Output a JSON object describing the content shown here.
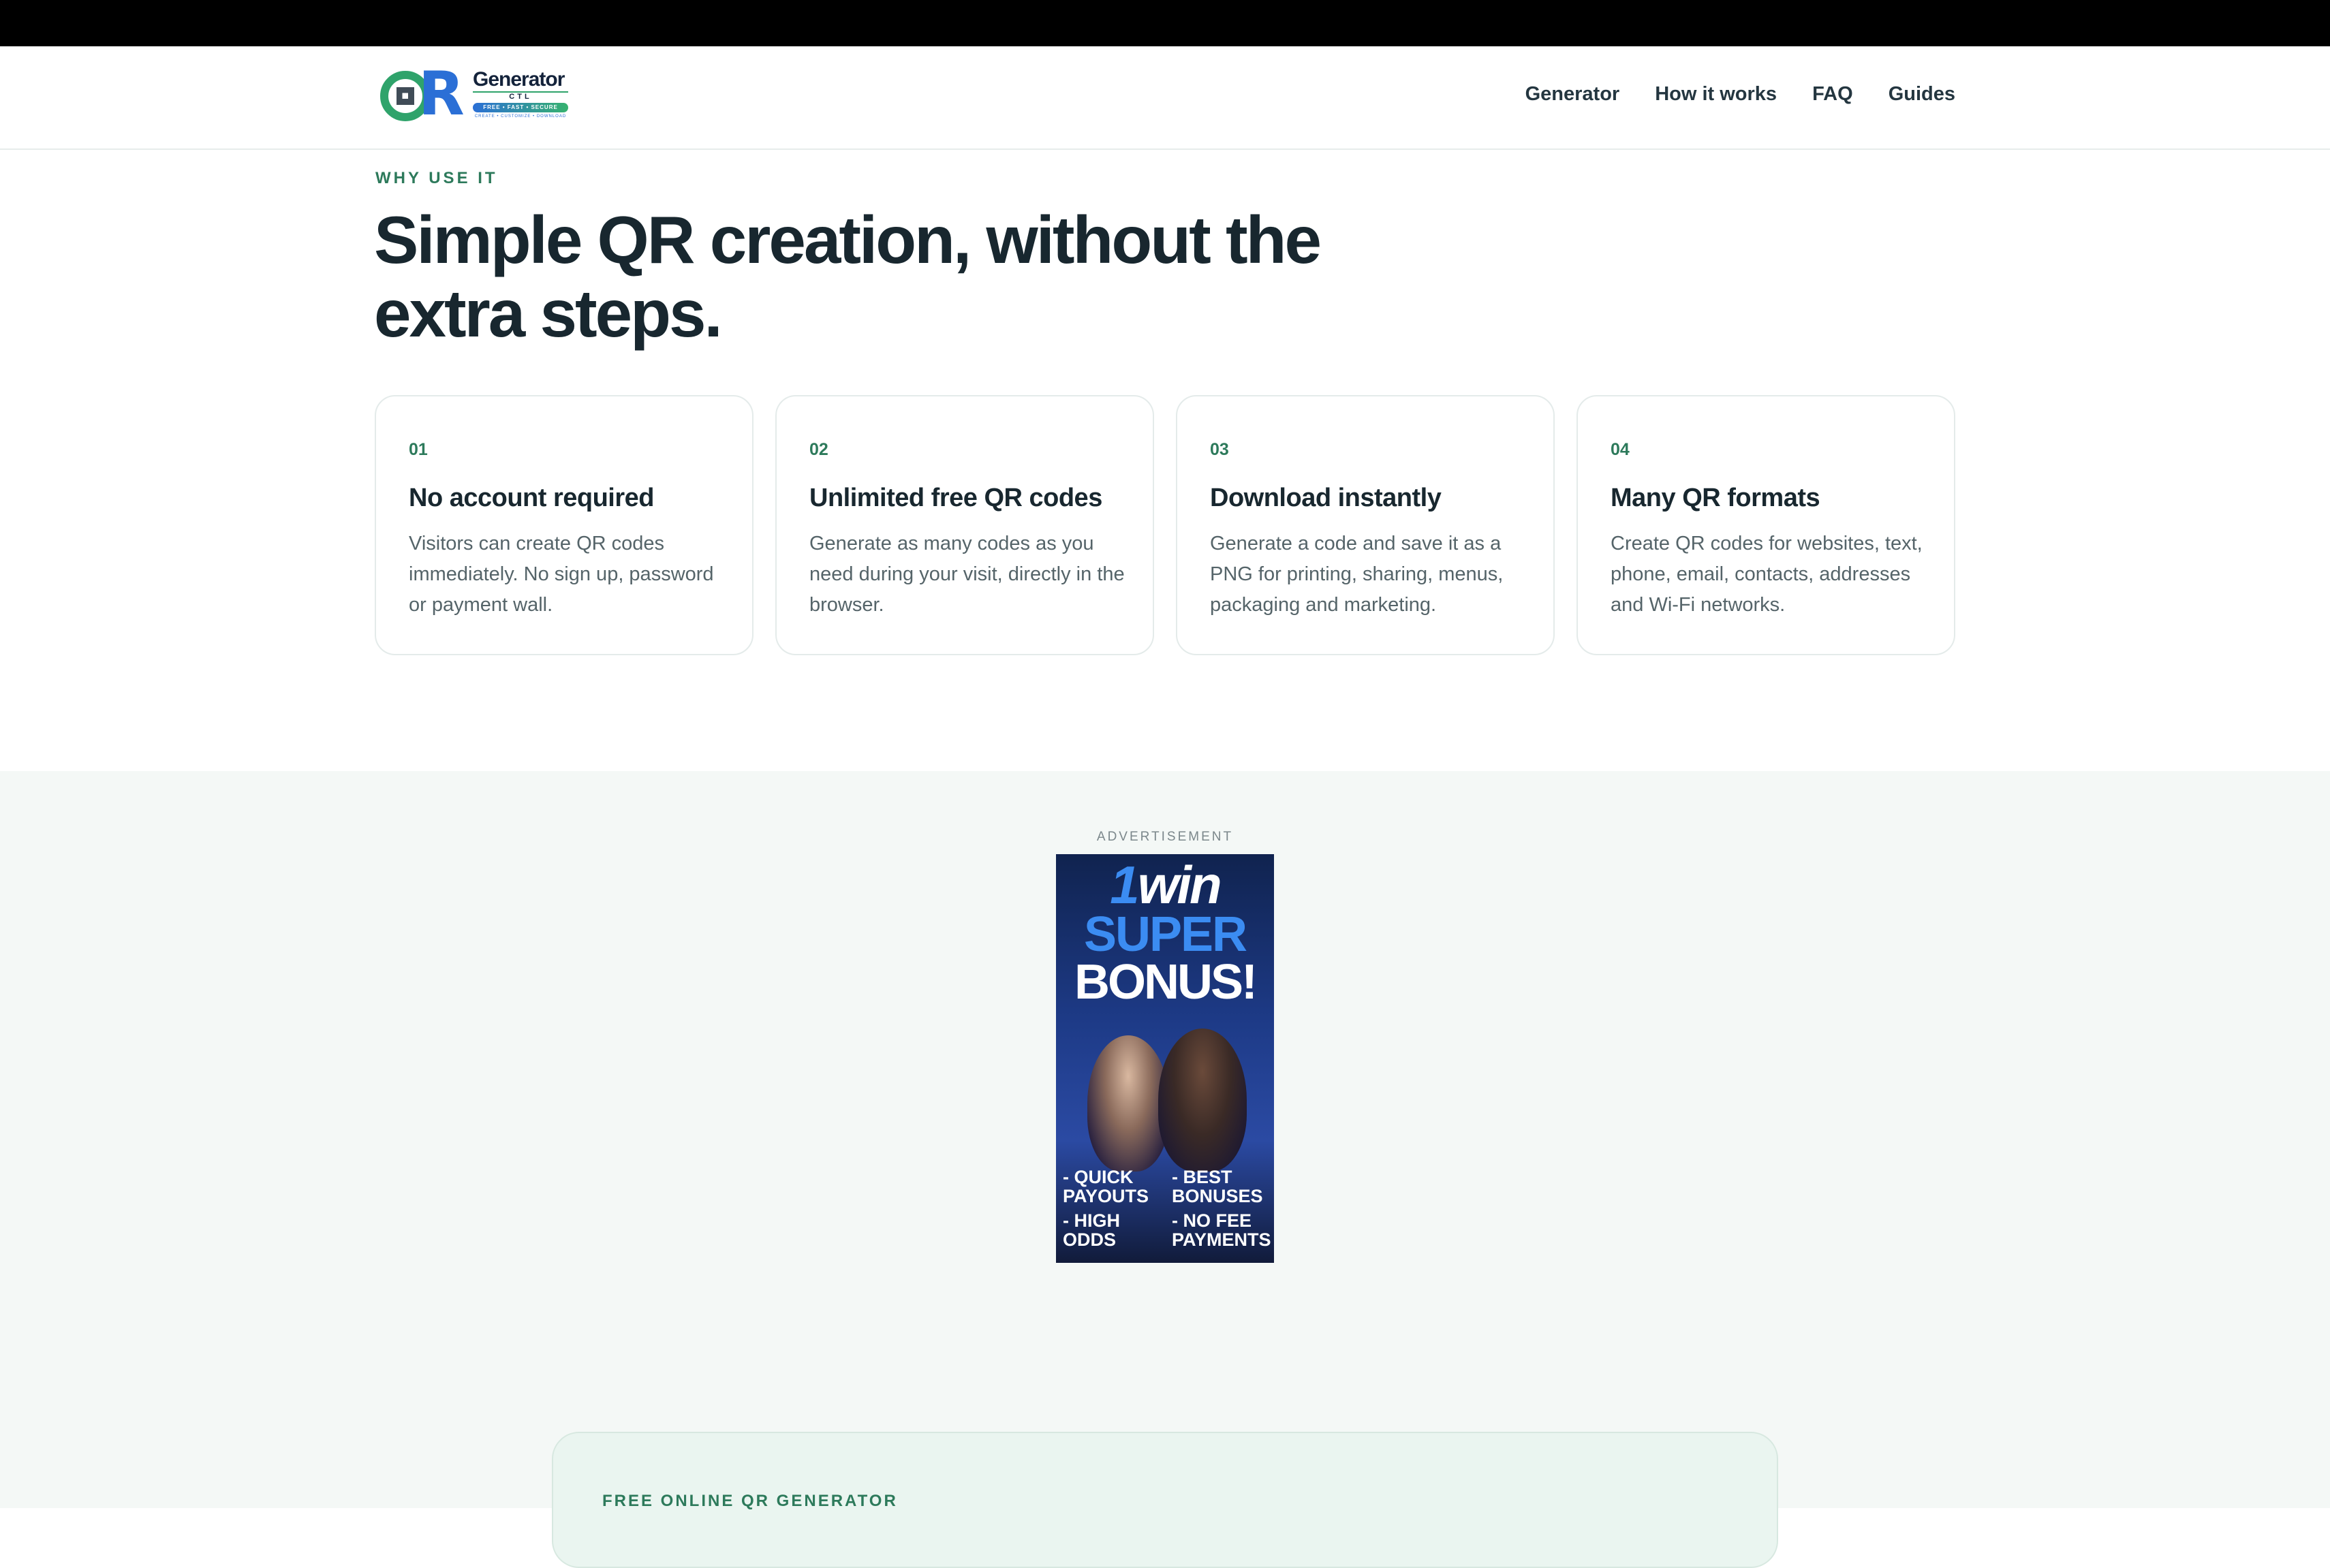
{
  "header": {
    "logo": {
      "text": "Generator",
      "sub": "CTL",
      "pill": "FREE • FAST • SECURE",
      "small": "CREATE • CUSTOMIZE • DOWNLOAD",
      "mark": "QR"
    },
    "nav": [
      {
        "label": "Generator"
      },
      {
        "label": "How it works"
      },
      {
        "label": "FAQ"
      },
      {
        "label": "Guides"
      }
    ]
  },
  "why": {
    "eyebrow": "WHY USE IT",
    "headline": "Simple QR creation, without the extra steps.",
    "cards": [
      {
        "num": "01",
        "title": "No account required",
        "desc": "Visitors can create QR codes immediately. No sign up, password or payment wall."
      },
      {
        "num": "02",
        "title": "Unlimited free QR codes",
        "desc": "Generate as many codes as you need during your visit, directly in the browser."
      },
      {
        "num": "03",
        "title": "Download instantly",
        "desc": "Generate a code and save it as a PNG for printing, sharing, menus, packaging and marketing."
      },
      {
        "num": "04",
        "title": "Many QR formats",
        "desc": "Create QR codes for websites, text, phone, email, contacts, addresses and Wi-Fi networks."
      }
    ]
  },
  "ad": {
    "label": "ADVERTISEMENT",
    "brand_one": "1",
    "brand_rest": "win",
    "super": "SUPER",
    "bonus": "BONUS!",
    "bullets": [
      [
        "- QUICK PAYOUTS",
        "- BEST BONUSES"
      ],
      [
        "- HIGH ODDS",
        "- NO FEE PAYMENTS"
      ]
    ]
  },
  "promo": {
    "eyebrow": "FREE ONLINE QR GENERATOR"
  }
}
